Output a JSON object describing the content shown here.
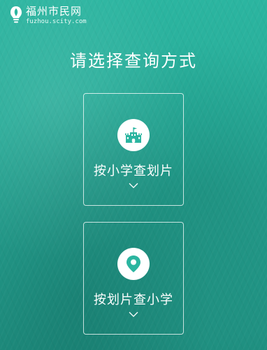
{
  "header": {
    "site_name": "福州市民网",
    "site_url": "fuzhou.scity.com",
    "logo_icon": "lightbulb-leaf-icon"
  },
  "main": {
    "title": "请选择查询方式",
    "options": [
      {
        "label": "按小学查划片",
        "icon": "school-building-icon",
        "chevron": "chevron-down-icon"
      },
      {
        "label": "按划片查小学",
        "icon": "map-pin-icon",
        "chevron": "chevron-down-icon"
      }
    ]
  },
  "colors": {
    "background": "#27ab98",
    "accent": "#2bb5a0",
    "text": "#ffffff"
  }
}
